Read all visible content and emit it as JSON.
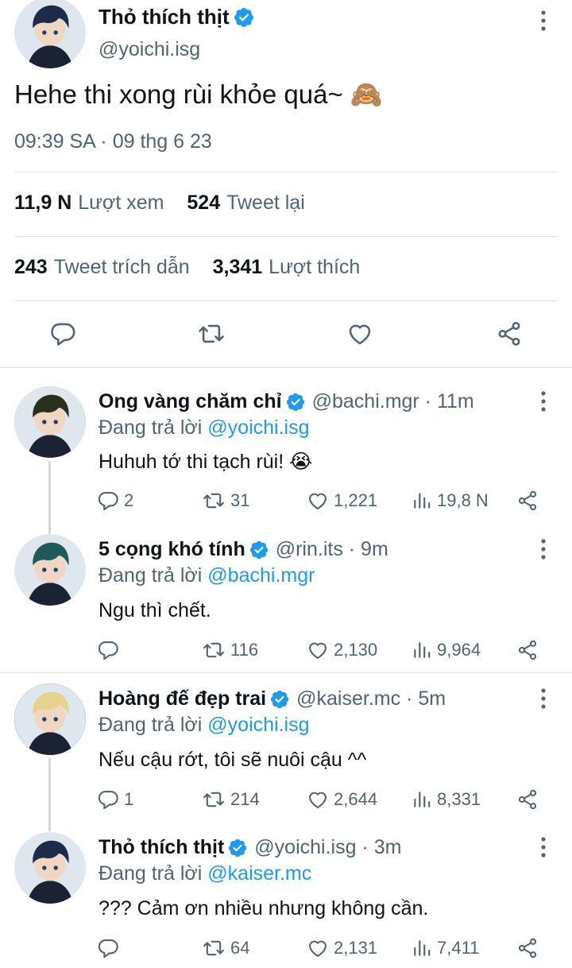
{
  "main_tweet": {
    "display_name": "Thỏ thích thịt",
    "handle": "@yoichi.isg",
    "text": "Hehe thi xong rùi khỏe quá~ 🙈",
    "timestamp": "09:39 SA · 09 thg 6 23",
    "stats": [
      {
        "value": "11,9 N",
        "label": "Lượt xem"
      },
      {
        "value": "524",
        "label": "Tweet lại"
      },
      {
        "value": "243",
        "label": "Tweet trích dẫn"
      },
      {
        "value": "3,341",
        "label": "Lượt thích"
      }
    ],
    "actions": [
      "reply-icon",
      "retweet-icon",
      "like-icon",
      "share-icon"
    ]
  },
  "replies": [
    {
      "display_name": "Ong vàng chăm chỉ",
      "handle_time": "@bachi.mgr · 11m",
      "replying_prefix": "Đang trả lời",
      "replying_to": "@yoichi.isg",
      "text": "Huhuh tớ thi tạch rùi! 😭",
      "replies": "2",
      "retweets": "31",
      "likes": "1,221",
      "views": "19,8 N",
      "avatar_color": "#6b7a3a"
    },
    {
      "display_name": "5 cọng khó tính",
      "handle_time": "@rin.its · 9m",
      "replying_prefix": "Đang trả lời",
      "replying_to": "@bachi.mgr",
      "text": "Ngu thì chết.",
      "replies": "",
      "retweets": "116",
      "likes": "2,130",
      "views": "9,964",
      "avatar_color": "#2f6e6a"
    },
    {
      "display_name": "Hoàng đế đẹp trai",
      "handle_time": "@kaiser.mc · 5m",
      "replying_prefix": "Đang trả lời",
      "replying_to": "@yoichi.isg",
      "text": "Nếu cậu rớt, tôi sẽ nuôi cậu ^^",
      "replies": "1",
      "retweets": "214",
      "likes": "2,644",
      "views": "8,331",
      "avatar_color": "#3a4a6a"
    },
    {
      "display_name": "Thỏ thích thịt",
      "handle_time": "@yoichi.isg · 3m",
      "replying_prefix": "Đang trả lời",
      "replying_to": "@kaiser.mc",
      "text": "??? Cảm ơn nhiều nhưng không cần.",
      "replies": "",
      "retweets": "64",
      "likes": "2,131",
      "views": "7,411",
      "avatar_color": "#1d2a4a"
    }
  ],
  "colors": {
    "accent": "#1d9bf0",
    "secondary_text": "#536471",
    "primary_text": "#0f1419",
    "divider": "#dfe3e6"
  }
}
